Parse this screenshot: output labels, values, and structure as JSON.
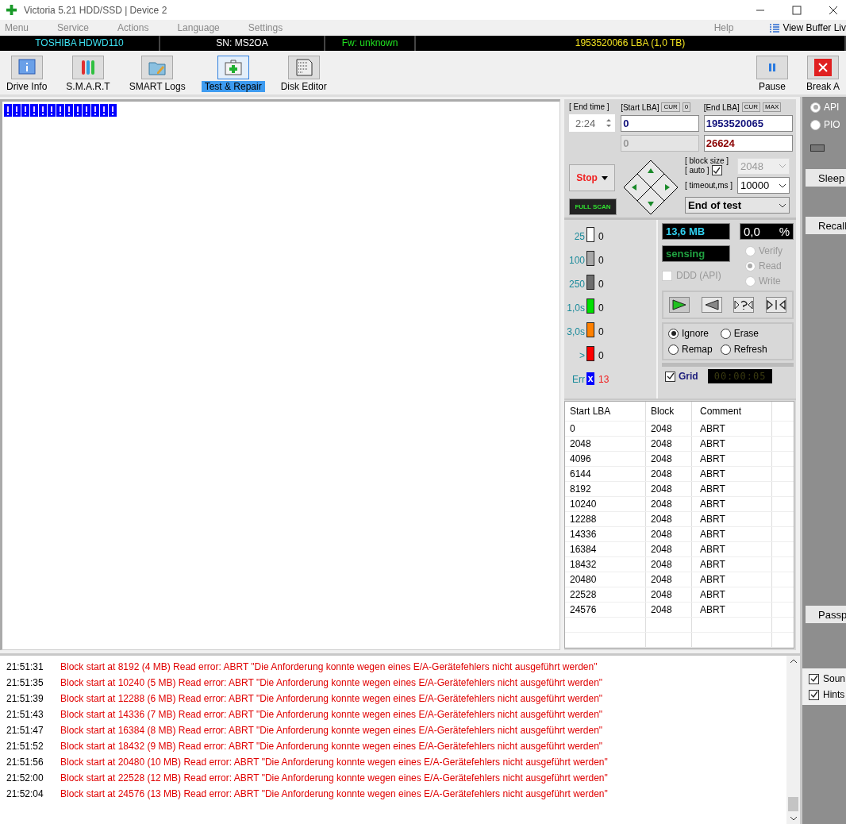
{
  "window": {
    "title": "Victoria 5.21 HDD/SSD | Device 2"
  },
  "menu": [
    {
      "label": "Menu"
    },
    {
      "label": "Service"
    },
    {
      "label": "Actions"
    },
    {
      "label": "Language"
    },
    {
      "label": "Settings"
    }
  ],
  "menu_right": {
    "help": "Help",
    "view_buffer": "View Buffer Liv"
  },
  "info_bar": {
    "model": "TOSHIBA HDWD110",
    "serial": "SN: MS2OA",
    "firmware": "Fw: unknown",
    "capacity": "1953520066 LBA (1,0 TB)"
  },
  "toolbar": [
    {
      "label": "Drive Info",
      "kind": "info",
      "selected": false
    },
    {
      "label": "S.M.A.R.T",
      "kind": "smart",
      "selected": false
    },
    {
      "label": "SMART Logs",
      "kind": "logs",
      "selected": false
    },
    {
      "label": "Test & Repair",
      "kind": "test",
      "selected": true
    },
    {
      "label": "Disk Editor",
      "kind": "editor",
      "selected": false
    }
  ],
  "toolbar_right": [
    {
      "label": "Pause",
      "kind": "pause"
    },
    {
      "label": "Break A",
      "kind": "break"
    }
  ],
  "block_map": [
    {
      "kind": "error"
    },
    {
      "kind": "error"
    },
    {
      "kind": "error"
    },
    {
      "kind": "error"
    },
    {
      "kind": "error"
    },
    {
      "kind": "error"
    },
    {
      "kind": "error"
    },
    {
      "kind": "error"
    },
    {
      "kind": "error"
    },
    {
      "kind": "error"
    },
    {
      "kind": "error"
    },
    {
      "kind": "error"
    },
    {
      "kind": "error"
    }
  ],
  "test": {
    "end_time_label": "[ End time ]",
    "end_time": "2:24",
    "start_lba_label": "[Start LBA]",
    "start_cur": "CUR",
    "start_zero": "0",
    "start_lba": "0",
    "end_lba_label": "[End LBA]",
    "end_cur": "CUR",
    "end_max": "MAX",
    "end_lba": "1953520065",
    "current_lba": "0",
    "remaining": "26624",
    "stop": "Stop",
    "full_scan": "FULL SCAN",
    "block_size_label": "[ block size ]",
    "auto_label": "[ auto ]",
    "auto_checked": true,
    "block_size": "2048",
    "timeout_label": "[ timeout,ms ]",
    "timeout": "10000",
    "end_action": "End of test"
  },
  "legend": [
    {
      "label": "25",
      "count": "0",
      "color": "#ffffff"
    },
    {
      "label": "100",
      "count": "0",
      "color": "#a8a8a8"
    },
    {
      "label": "250",
      "count": "0",
      "color": "#6e6e6e"
    },
    {
      "label": "1,0s",
      "count": "0",
      "color": "#00e000"
    },
    {
      "label": "3,0s",
      "count": "0",
      "color": "#ff8000"
    },
    {
      "label": ">",
      "count": "0",
      "color": "#ff0000"
    }
  ],
  "errors": {
    "label": "Err",
    "mark": "x",
    "count": "13"
  },
  "stats": {
    "speed": "13,6 MB",
    "percent": "0,0",
    "percent_sign": "%",
    "status": "sensing"
  },
  "ddd": {
    "label": "DDD (API)",
    "checked": false
  },
  "modes": [
    {
      "label": "Verify",
      "selected": false
    },
    {
      "label": "Read",
      "selected": true
    },
    {
      "label": "Write",
      "selected": false
    }
  ],
  "directions": [
    {
      "kind": "forward",
      "selected": true
    },
    {
      "kind": "backward",
      "selected": false
    },
    {
      "kind": "random",
      "selected": false
    },
    {
      "kind": "butterfly",
      "selected": false
    }
  ],
  "actions": [
    {
      "label": "Ignore",
      "selected": true
    },
    {
      "label": "Erase",
      "selected": false
    },
    {
      "label": "Remap",
      "selected": false
    },
    {
      "label": "Refresh",
      "selected": false
    }
  ],
  "grid": {
    "label": "Grid",
    "checked": true
  },
  "timer": "00:00:05",
  "table": {
    "columns": [
      "Start LBA",
      "Block",
      "Comment"
    ],
    "rows": [
      [
        "0",
        "2048",
        "ABRT"
      ],
      [
        "2048",
        "2048",
        "ABRT"
      ],
      [
        "4096",
        "2048",
        "ABRT"
      ],
      [
        "6144",
        "2048",
        "ABRT"
      ],
      [
        "8192",
        "2048",
        "ABRT"
      ],
      [
        "10240",
        "2048",
        "ABRT"
      ],
      [
        "12288",
        "2048",
        "ABRT"
      ],
      [
        "14336",
        "2048",
        "ABRT"
      ],
      [
        "16384",
        "2048",
        "ABRT"
      ],
      [
        "18432",
        "2048",
        "ABRT"
      ],
      [
        "20480",
        "2048",
        "ABRT"
      ],
      [
        "22528",
        "2048",
        "ABRT"
      ],
      [
        "24576",
        "2048",
        "ABRT"
      ]
    ]
  },
  "interface": [
    {
      "label": "API",
      "selected": true
    },
    {
      "label": "PIO",
      "selected": false
    }
  ],
  "side_buttons": [
    {
      "label": "Sleep"
    },
    {
      "label": "Recall"
    },
    {
      "label": "Passp"
    }
  ],
  "log": [
    {
      "time": "21:51:31",
      "text": "Block start at 8192 (4 MB) Read error: ABRT \"Die Anforderung konnte wegen eines E/A-Gerätefehlers nicht ausgeführt werden\""
    },
    {
      "time": "21:51:35",
      "text": "Block start at 10240 (5 MB) Read error: ABRT \"Die Anforderung konnte wegen eines E/A-Gerätefehlers nicht ausgeführt werden\""
    },
    {
      "time": "21:51:39",
      "text": "Block start at 12288 (6 MB) Read error: ABRT \"Die Anforderung konnte wegen eines E/A-Gerätefehlers nicht ausgeführt werden\""
    },
    {
      "time": "21:51:43",
      "text": "Block start at 14336 (7 MB) Read error: ABRT \"Die Anforderung konnte wegen eines E/A-Gerätefehlers nicht ausgeführt werden\""
    },
    {
      "time": "21:51:47",
      "text": "Block start at 16384 (8 MB) Read error: ABRT \"Die Anforderung konnte wegen eines E/A-Gerätefehlers nicht ausgeführt werden\""
    },
    {
      "time": "21:51:52",
      "text": "Block start at 18432 (9 MB) Read error: ABRT \"Die Anforderung konnte wegen eines E/A-Gerätefehlers nicht ausgeführt werden\""
    },
    {
      "time": "21:51:56",
      "text": "Block start at 20480 (10 MB) Read error: ABRT \"Die Anforderung konnte wegen eines E/A-Gerätefehlers nicht ausgeführt werden\""
    },
    {
      "time": "21:52:00",
      "text": "Block start at 22528 (12 MB) Read error: ABRT \"Die Anforderung konnte wegen eines E/A-Gerätefehlers nicht ausgeführt werden\""
    },
    {
      "time": "21:52:04",
      "text": "Block start at 24576 (13 MB) Read error: ABRT \"Die Anforderung konnte wegen eines E/A-Gerätefehlers nicht ausgeführt werden\""
    }
  ],
  "options": [
    {
      "label": "Soun",
      "checked": true
    },
    {
      "label": "Hints",
      "checked": true
    }
  ]
}
